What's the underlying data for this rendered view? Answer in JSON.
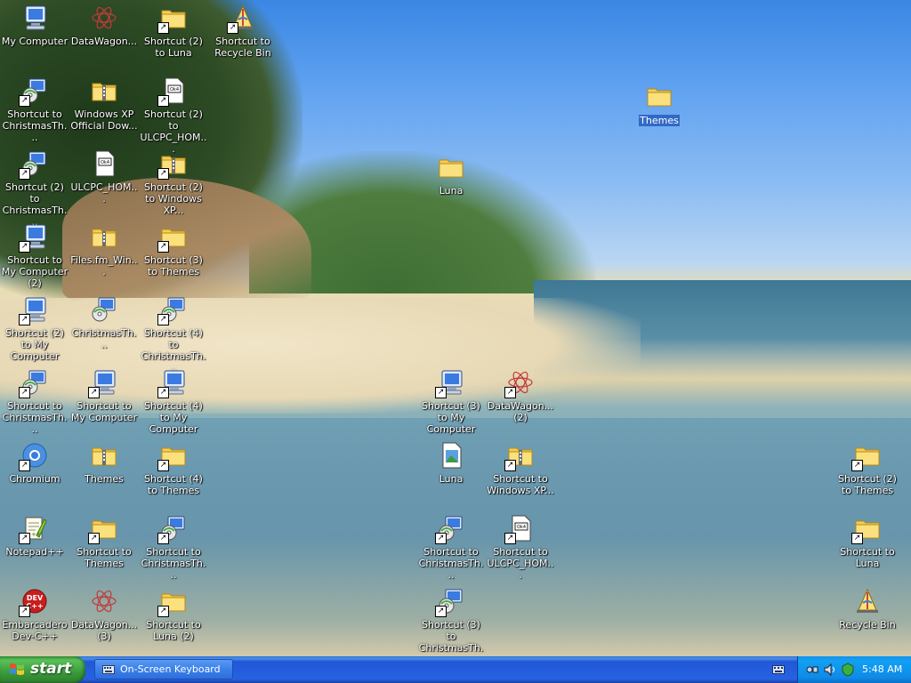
{
  "desktop_icons": [
    {
      "label": "My Computer",
      "icon": "computer-icon",
      "shortcut": false
    },
    {
      "label": "DataWagon...",
      "icon": "datawagon-icon",
      "shortcut": false
    },
    {
      "label": "Shortcut (2) to Luna",
      "icon": "folder-icon",
      "shortcut": true
    },
    {
      "label": "Shortcut to Recycle Bin",
      "icon": "recycle-bin-icon",
      "shortcut": true
    },
    {
      "label": "Themes",
      "icon": "folder-icon",
      "shortcut": false,
      "selected": true
    },
    {
      "label": "Shortcut to ChristmasTh...",
      "icon": "christmas-theme-icon",
      "shortcut": true
    },
    {
      "label": "Windows XP Official Dow...",
      "icon": "zip-folder-icon",
      "shortcut": false
    },
    {
      "label": "Shortcut (2) to ULCPC_HOM...",
      "icon": "document-icon",
      "shortcut": true
    },
    {
      "label": "Luna",
      "icon": "folder-icon",
      "shortcut": false
    },
    {
      "label": "Shortcut (2) to ChristmasTh...",
      "icon": "christmas-theme-icon",
      "shortcut": true
    },
    {
      "label": "ULCPC_HOM...",
      "icon": "document-icon",
      "shortcut": false
    },
    {
      "label": "Shortcut (2) to Windows XP...",
      "icon": "zip-folder-icon",
      "shortcut": true
    },
    {
      "label": "Shortcut to My Computer (2)",
      "icon": "computer-icon",
      "shortcut": true
    },
    {
      "label": "Files.fm_Win...",
      "icon": "zip-folder-icon",
      "shortcut": false
    },
    {
      "label": "Shortcut (3) to Themes",
      "icon": "folder-icon",
      "shortcut": true
    },
    {
      "label": "Shortcut (2) to My Computer",
      "icon": "computer-icon",
      "shortcut": true
    },
    {
      "label": "ChristmasTh...",
      "icon": "christmas-theme-icon",
      "shortcut": false
    },
    {
      "label": "Shortcut (4) to ChristmasTh...",
      "icon": "christmas-theme-icon",
      "shortcut": true
    },
    {
      "label": "Shortcut to ChristmasTh...",
      "icon": "christmas-theme-icon",
      "shortcut": true
    },
    {
      "label": "Shortcut to My Computer",
      "icon": "computer-icon",
      "shortcut": true
    },
    {
      "label": "Shortcut (4) to My Computer",
      "icon": "computer-icon",
      "shortcut": true
    },
    {
      "label": "Shortcut (3) to My Computer",
      "icon": "computer-icon",
      "shortcut": true
    },
    {
      "label": "DataWagon... (2)",
      "icon": "datawagon-icon",
      "shortcut": true
    },
    {
      "label": "Chromium",
      "icon": "chromium-icon",
      "shortcut": true
    },
    {
      "label": "Themes",
      "icon": "zip-folder-icon",
      "shortcut": false
    },
    {
      "label": "Shortcut (4) to Themes",
      "icon": "folder-icon",
      "shortcut": true
    },
    {
      "label": "Luna",
      "icon": "image-file-icon",
      "shortcut": false
    },
    {
      "label": "Shortcut to Windows XP...",
      "icon": "zip-folder-icon",
      "shortcut": true
    },
    {
      "label": "Shortcut (2) to Themes",
      "icon": "folder-icon",
      "shortcut": true
    },
    {
      "label": "Notepad++",
      "icon": "notepad-plus-plus-icon",
      "shortcut": true
    },
    {
      "label": "Shortcut to Themes",
      "icon": "folder-icon",
      "shortcut": true
    },
    {
      "label": "Shortcut to ChristmasTh...",
      "icon": "christmas-theme-icon",
      "shortcut": true
    },
    {
      "label": "Shortcut to ChristmasTh...",
      "icon": "christmas-theme-icon",
      "shortcut": true
    },
    {
      "label": "Shortcut to ULCPC_HOM...",
      "icon": "document-icon",
      "shortcut": true
    },
    {
      "label": "Shortcut to Luna",
      "icon": "folder-icon",
      "shortcut": true
    },
    {
      "label": "Embarcadero Dev-C++",
      "icon": "dev-cpp-icon",
      "shortcut": true
    },
    {
      "label": "DataWagon... (3)",
      "icon": "datawagon-icon",
      "shortcut": false
    },
    {
      "label": "Shortcut to Luna (2)",
      "icon": "folder-icon",
      "shortcut": true
    },
    {
      "label": "Shortcut (3) to ChristmasTh...",
      "icon": "christmas-theme-icon",
      "shortcut": true
    },
    {
      "label": "Recycle Bin",
      "icon": "recycle-bin-icon",
      "shortcut": false
    }
  ],
  "taskbar": {
    "start_label": "start",
    "task_label": "On-Screen Keyboard",
    "clock": "5:48 AM"
  },
  "colors": {
    "taskbar_blue": "#2663e0",
    "start_green": "#3a9b3a",
    "tray_blue": "#0f8ae6",
    "selection_blue": "#316ac5"
  }
}
